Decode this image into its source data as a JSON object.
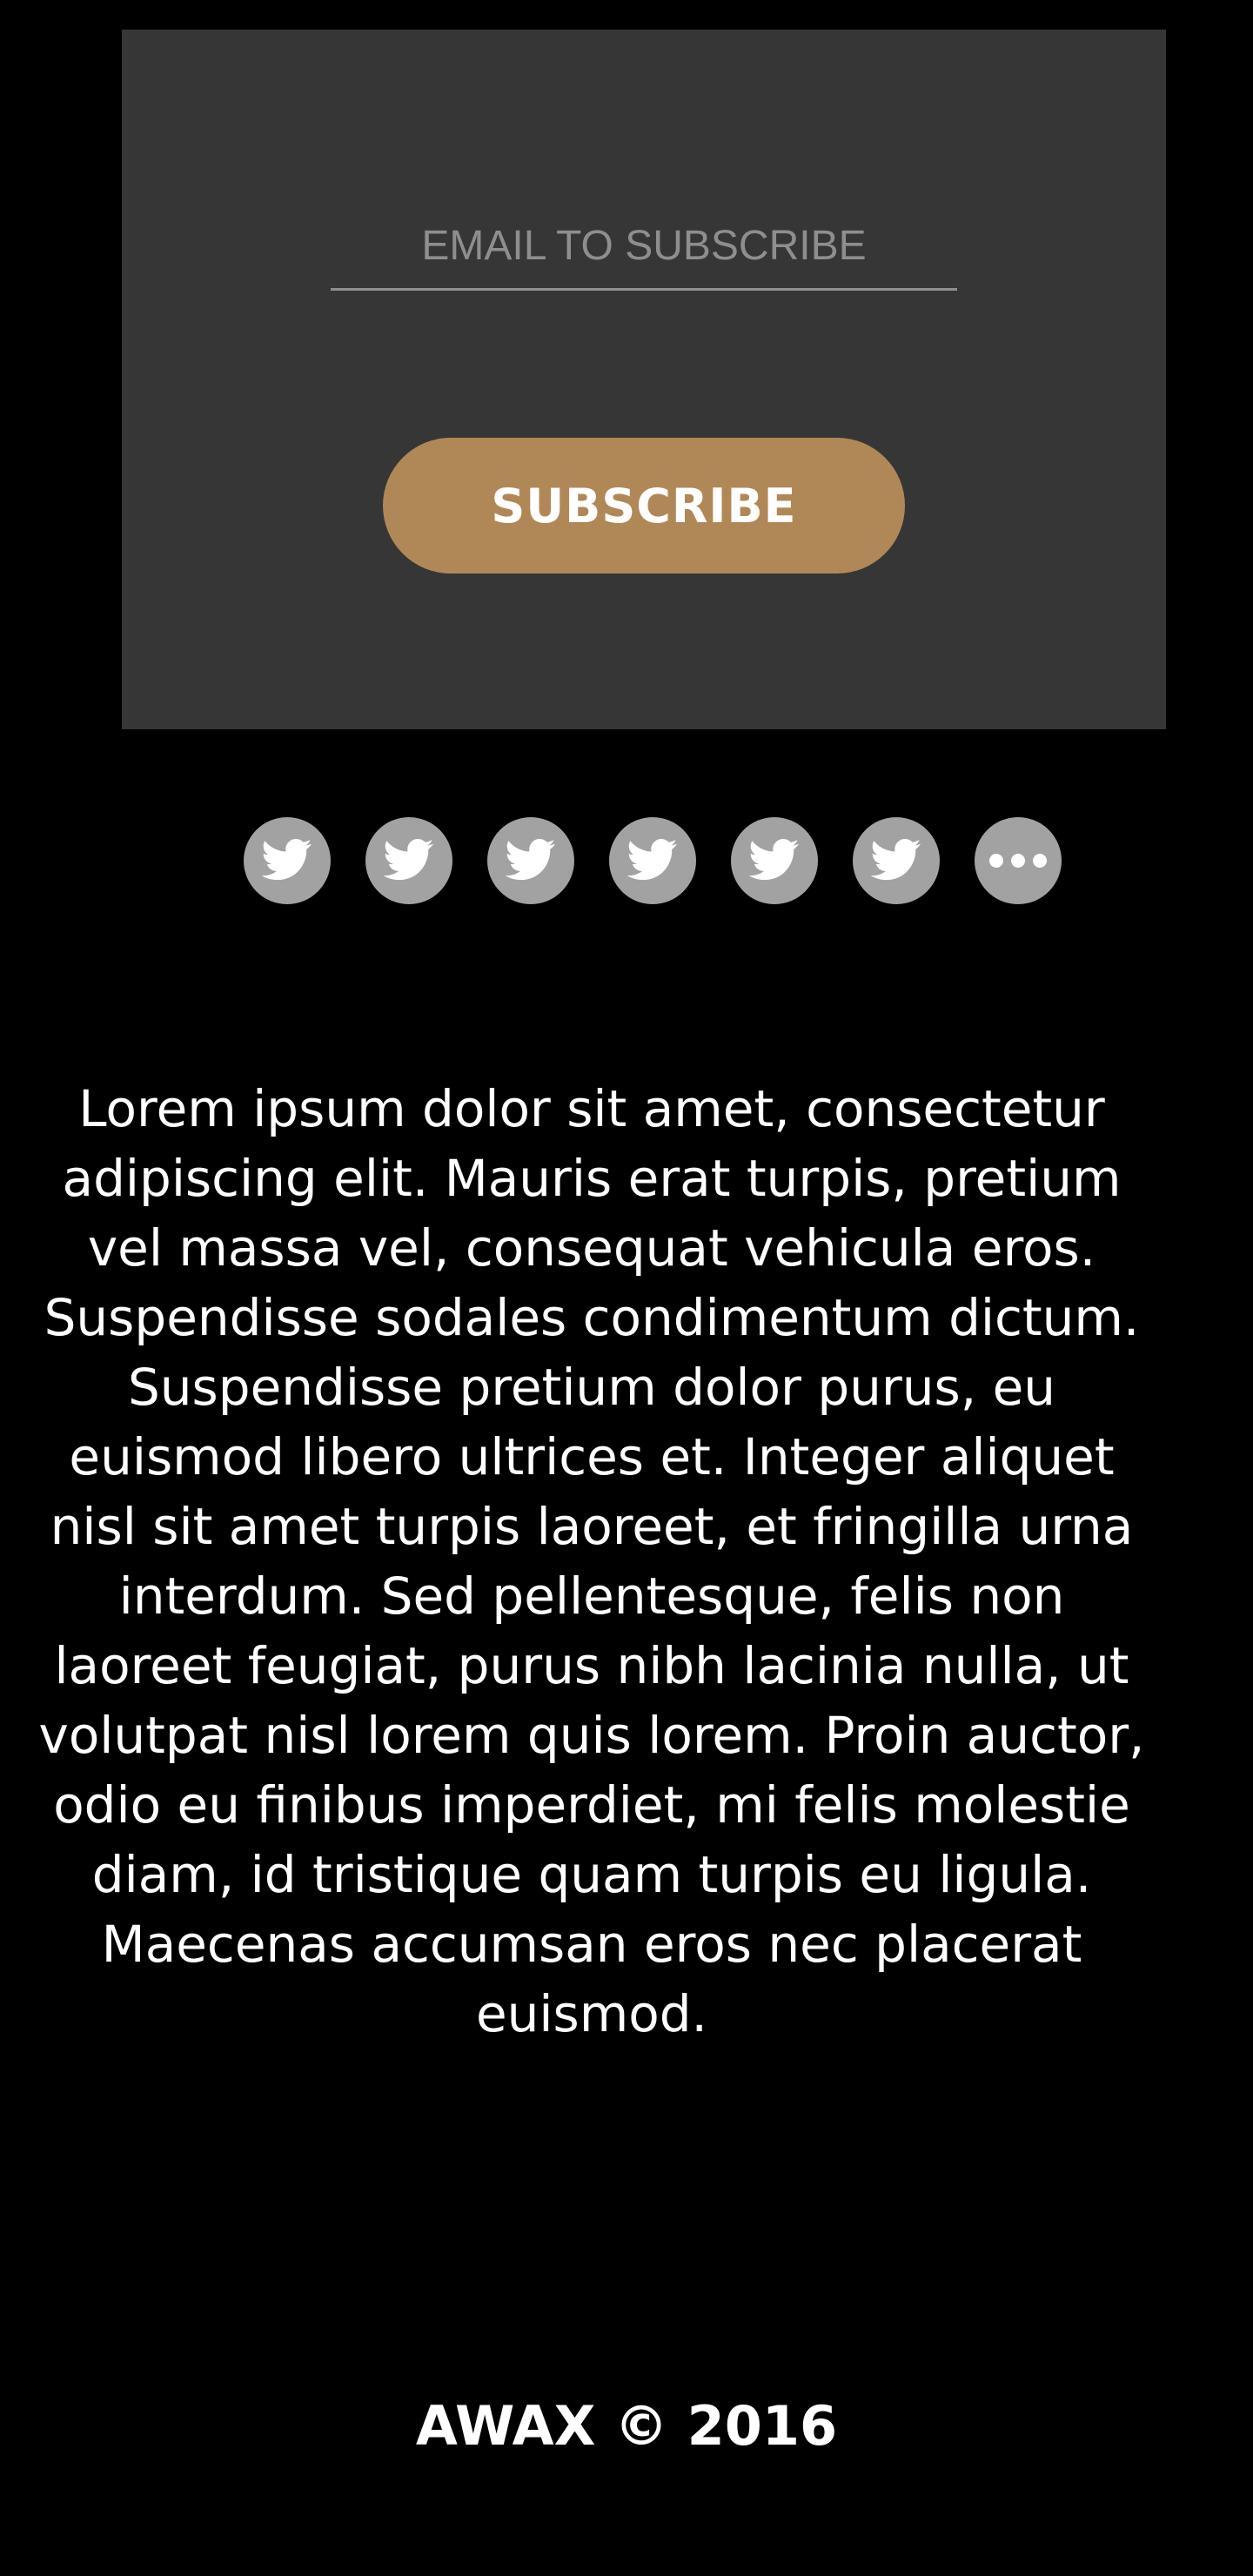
{
  "subscribe": {
    "email_placeholder": "EMAIL TO SUBSCRIBE",
    "email_value": "",
    "button_label": "SUBSCRIBE",
    "button_color": "#b08858",
    "panel_color": "#363636"
  },
  "social": {
    "icons": [
      "twitter-icon",
      "twitter-icon",
      "twitter-icon",
      "twitter-icon",
      "twitter-icon",
      "twitter-icon",
      "more-icon"
    ],
    "icon_bg_color": "#a2a2a2"
  },
  "content": {
    "paragraph": "Lorem ipsum dolor sit amet, consectetur adipiscing elit. Mauris erat turpis, pretium vel massa vel, consequat vehicula eros. Suspendisse sodales condimentum dictum. Suspendisse pretium dolor purus, eu euismod libero ultrices et. Integer aliquet nisl sit amet turpis laoreet, et fringilla urna interdum. Sed pellentesque, felis non laoreet feugiat, purus nibh lacinia nulla, ut volutpat nisl lorem quis lorem. Proin auctor, odio eu finibus imperdiet, mi felis molestie diam, id tristique quam turpis eu ligula. Maecenas accumsan eros nec placerat euismod."
  },
  "footer": {
    "copyright": "AWAX © 2016"
  }
}
